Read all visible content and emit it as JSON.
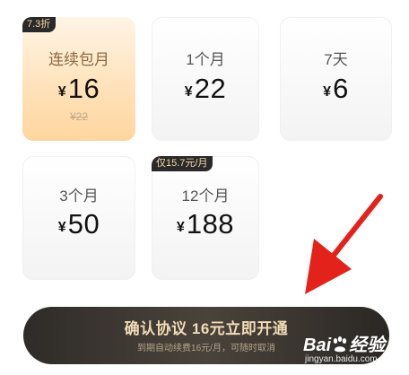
{
  "plans": [
    {
      "badge": "7.3折",
      "name": "连续包月",
      "currency": "¥",
      "price": "16",
      "original_price": "¥22",
      "selected": true
    },
    {
      "badge": "",
      "name": "1个月",
      "currency": "¥",
      "price": "22",
      "selected": false
    },
    {
      "badge": "",
      "name": "7天",
      "currency": "¥",
      "price": "6",
      "selected": false
    },
    {
      "badge": "",
      "name": "3个月",
      "currency": "¥",
      "price": "50",
      "selected": false
    },
    {
      "badge": "仅15.7元/月",
      "name": "12个月",
      "currency": "¥",
      "price": "188",
      "selected": false
    }
  ],
  "cta": {
    "label": "确认协议  16元立即开通",
    "sub": "到期自动续费16元/月，可随时取消"
  },
  "watermark": {
    "logo_text": "Bai",
    "logo_text_2": "经验",
    "url": "jingyan.baidu.com"
  },
  "colors": {
    "accent": "#f2dcb6",
    "selected_card": "#ffe1b8",
    "cta_bg": "#2e2b28",
    "arrow": "#e3231b"
  }
}
